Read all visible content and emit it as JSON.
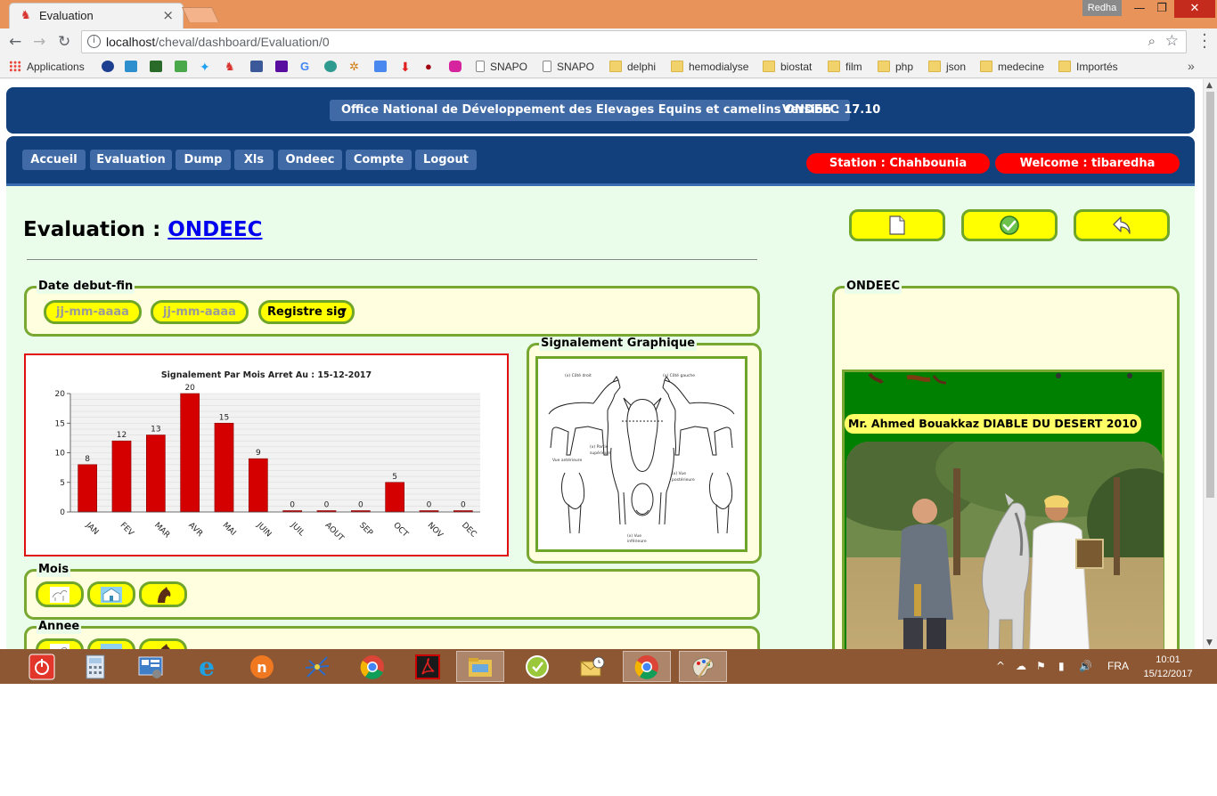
{
  "browser": {
    "tab_title": "Evaluation",
    "tab_close": "×",
    "url_host": "localhost",
    "url_path": "/cheval/dashboard/Evaluation/0",
    "window_user": "Redha",
    "window_min": "—",
    "window_max": "❐",
    "window_close": "✕",
    "bookmarks": {
      "apps": "Applications",
      "snapo1": "SNAPO",
      "snapo2": "SNAPO",
      "delphi": "delphi",
      "hemodialyse": "hemodialyse",
      "biostat": "biostat",
      "film": "film",
      "php": "php",
      "json": "json",
      "medecine": "medecine",
      "importes": "Importés",
      "more": "»"
    }
  },
  "header": {
    "org_title": "Office National de Développement des Elevages Equins et camelins ONDEEC",
    "version": "Version : 17.10"
  },
  "nav": {
    "accueil": "Accueil",
    "evaluation": "Evaluation",
    "dump": "Dump",
    "xls": "Xls",
    "ondeec": "Ondeec",
    "compte": "Compte",
    "logout": "Logout",
    "station": "Station : Chahbounia",
    "welcome": "Welcome : tibaredha"
  },
  "main": {
    "heading_prefix": "Evaluation : ",
    "heading_link": "ONDEEC",
    "date_legend": "Date debut-fin",
    "date_start_placeholder": "jj-mm-aaaa",
    "date_end_placeholder": "jj-mm-aaaa",
    "registre_select": "Registre sig",
    "sketch_legend": "Signalement Graphique",
    "mois_legend": "Mois",
    "annee_legend": "Annee",
    "photo_legend": "ONDEEC",
    "photo_caption": "Mr. Ahmed Bouakkaz DIABLE DU DESERT 2010"
  },
  "chart_data": {
    "type": "bar",
    "title": "Signalement Par Mois Arret Au : 15-12-2017",
    "categories": [
      "JAN",
      "FEV",
      "MAR",
      "AVR",
      "MAI",
      "JUIN",
      "JUIL",
      "AOUT",
      "SEP",
      "OCT",
      "NOV",
      "DEC"
    ],
    "values": [
      8,
      12,
      13,
      20,
      15,
      9,
      0,
      0,
      0,
      5,
      0,
      0
    ],
    "ylim": [
      0,
      20
    ],
    "yticks": [
      0,
      5,
      10,
      15,
      20
    ],
    "xlabel": "",
    "ylabel": "",
    "grid": true,
    "bar_color": "#d40000"
  },
  "taskbar": {
    "lang": "FRA",
    "time": "10:01",
    "date": "15/12/2017"
  },
  "colors": {
    "header_blue": "#11407c",
    "accent_green": "#78a832",
    "button_yellow": "#ffff00",
    "pill_red": "#ff0000"
  }
}
